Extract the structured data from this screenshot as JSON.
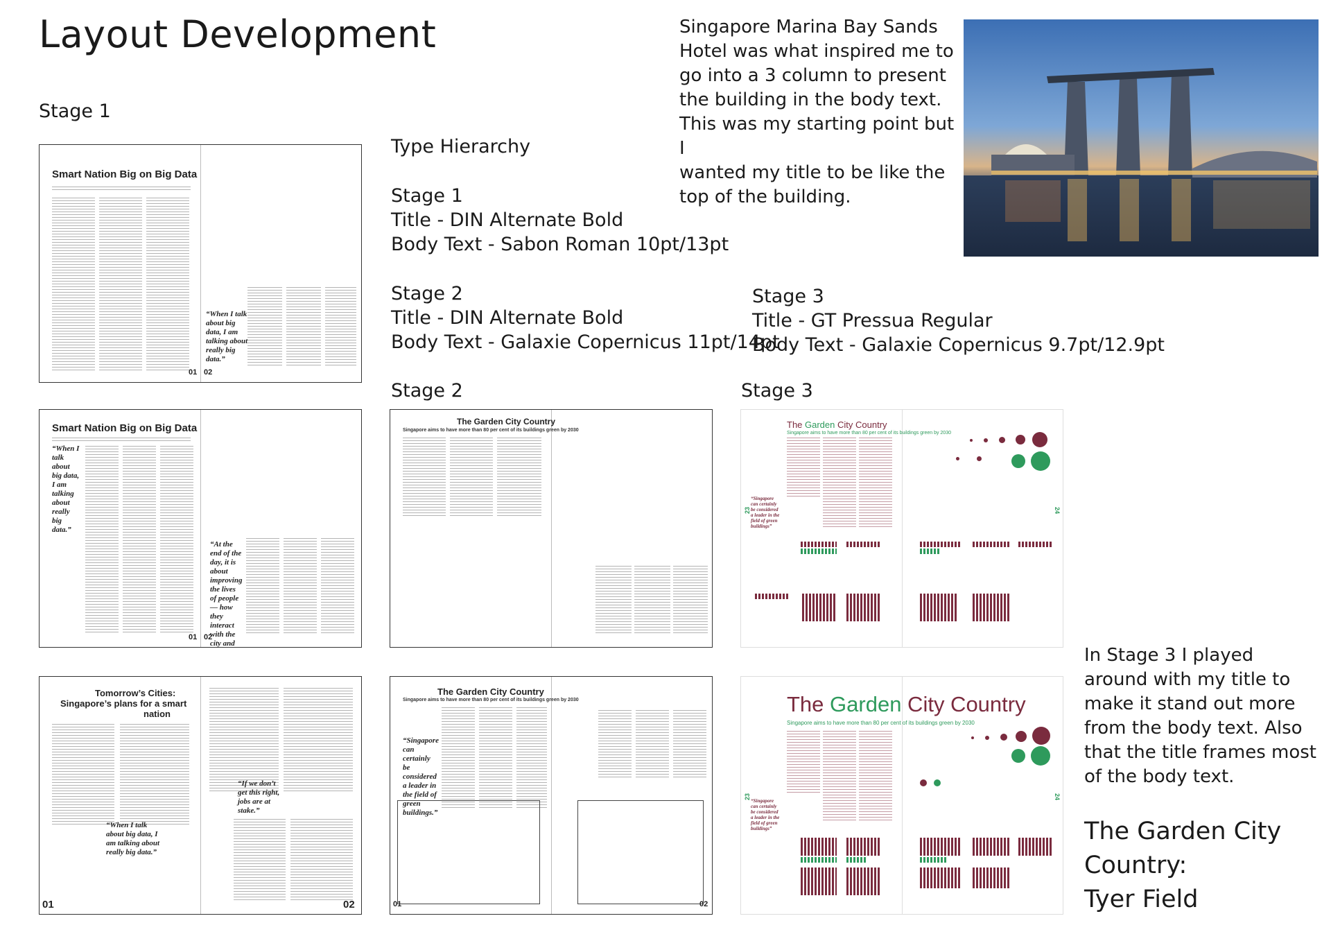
{
  "heading": "Layout Development",
  "labels": {
    "stage1": "Stage 1",
    "stage2": "Stage 2",
    "stage3": "Stage 3"
  },
  "inspiration_text": [
    "Singapore Marina Bay Sands",
    "Hotel was what inspired me to",
    "go into a 3 column to present",
    "the building in the body text.",
    "This was my starting point but I",
    "wanted my title to be like the",
    "top of the building."
  ],
  "type_hierarchy": {
    "heading": "Type Hierarchy",
    "stage1": {
      "label": "Stage 1",
      "title": "Title - DIN Alternate Bold",
      "body": "Body Text - Sabon Roman 10pt/13pt"
    },
    "stage2": {
      "label": "Stage 2",
      "title": "Title - DIN Alternate Bold",
      "body": "Body Text - Galaxie Copernicus 11pt/14pt"
    },
    "stage3": {
      "label": "Stage 3",
      "title": "Title - GT Pressua Regular",
      "body": "Body Text - Galaxie Copernicus 9.7pt/12.9pt"
    }
  },
  "stage3_note": [
    "In Stage 3 I played",
    "around with my title to",
    "make it stand out more",
    "from the body text. Also",
    "that the title frames most",
    "of the body text."
  ],
  "closing": [
    "The Garden City",
    "Country:",
    "Tyer Field"
  ],
  "spreads": {
    "s1a": {
      "title": "Smart Nation Big on Big Data",
      "quote": "“When I talk about big data, I am talking about really big data.”",
      "page_left": "01",
      "page_right": "02"
    },
    "s1b": {
      "title": "Smart Nation Big on Big Data",
      "quote_left": "“When I talk about big data, I am talking about really big data.”",
      "quote_right": "“At the end of the day, it is about improving the lives of people — how they interact with the city and how they experience the city.”",
      "page_left": "01",
      "page_right": "02"
    },
    "s1c": {
      "title_1": "Tomorrow’s Cities:",
      "title_2": "Singapore’s plans for a smart",
      "title_3": "nation",
      "quote_left": "“When I talk about big data, I am talking about really big data.”",
      "quote_right": "“If we don’t get this right, jobs are at stake.”",
      "page_left": "01",
      "page_right": "02"
    },
    "s2a": {
      "title": "The Garden City Country",
      "subtitle": "Singapore aims to have more than 80 per cent of its buildings green by 2030"
    },
    "s2b": {
      "title": "The Garden City Country",
      "subtitle": "Singapore aims to have more than 80 per cent of its buildings green by 2030",
      "quote": "“Singapore can certainly be considered a leader in the field of green buildings.”",
      "page_left": "01",
      "page_right": "02"
    },
    "s3a": {
      "title_part1": "The ",
      "title_green": "Garden",
      "title_part2": " City Country",
      "subtitle": "Singapore aims to have more than 80 per cent of its buildings green by 2030",
      "page_left": "23",
      "page_right": "24"
    },
    "s3b": {
      "title_part1": "The ",
      "title_green": "Garden",
      "title_part2": " City Country",
      "subtitle": "Singapore aims to have more than 80 per cent of its buildings green by 2030",
      "page_left": "23",
      "page_right": "24"
    }
  },
  "colors": {
    "maroon": "#7a2b3e",
    "green": "#2e9a5c"
  }
}
